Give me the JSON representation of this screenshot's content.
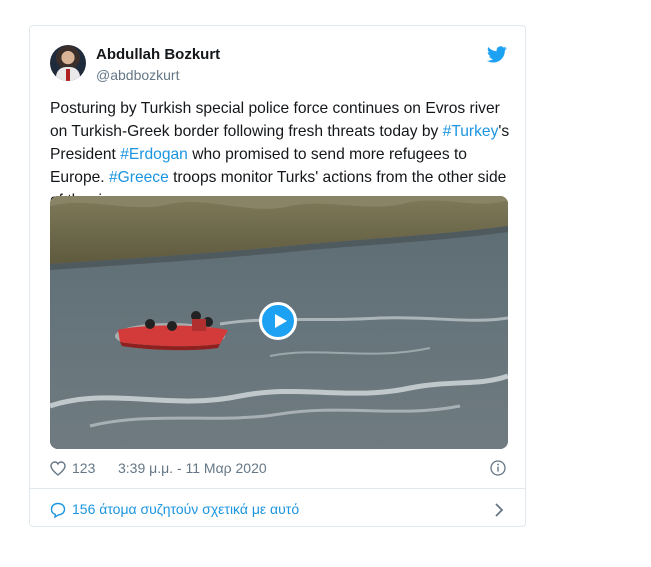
{
  "tweet": {
    "author_name": "Abdullah Bozkurt",
    "author_handle": "@abdbozkurt",
    "text_parts": [
      "Posturing by Turkish special police force continues on Evros river on Turkish-Greek border following fresh threats today by ",
      "#Turkey",
      "'s President ",
      "#Erdogan",
      " who promised to send more refugees to Europe. ",
      "#Greece",
      " troops monitor Turks' actions from the other side of the river."
    ],
    "like_count": "123",
    "timestamp": "3:39 μ.μ. - 11 Μαρ 2020",
    "conversation_label": "156 άτομα συζητούν σχετικά με αυτό"
  },
  "icons": {
    "brand": "twitter-bird-icon",
    "like": "heart-icon",
    "info": "info-icon",
    "conversation": "speech-bubble-icon",
    "more": "chevron-right-icon",
    "media": "play-icon"
  },
  "colors": {
    "link": "#1b95e0",
    "brand": "#1da1f2",
    "muted": "#657786",
    "border": "#e1e8ed"
  }
}
